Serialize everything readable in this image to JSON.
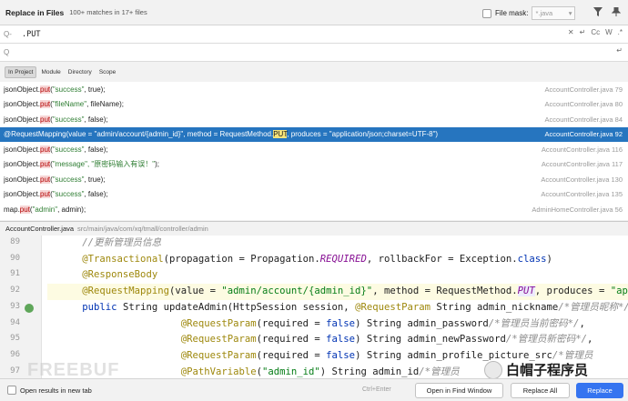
{
  "dialog": {
    "title": "Replace in Files",
    "match_count": "100+ matches in 17+ files",
    "file_mask_label": "File mask:",
    "file_mask_value": "*.java"
  },
  "search": {
    "find_value": ".PUT",
    "replace_value": "",
    "find_options": [
      "Cc",
      "W",
      ".*"
    ]
  },
  "scope_tabs": [
    "In Project",
    "Module",
    "Directory",
    "Scope"
  ],
  "results": [
    {
      "pre": "jsonObject.",
      "match": "put",
      "post_str": "\"success\"",
      "post": ", true);",
      "file": "AccountController.java 79"
    },
    {
      "pre": "jsonObject.",
      "match": "put",
      "post_str": "\"fileName\"",
      "post": ", fileName);",
      "file": "AccountController.java 80"
    },
    {
      "pre": "jsonObject.",
      "match": "put",
      "post_str": "\"success\"",
      "post": ", false);",
      "file": "AccountController.java 84"
    },
    {
      "pre": "@RequestMapping(value = \"admin/account/{admin_id}\", method = RequestMethod.",
      "match": "PUT",
      "post_str": "",
      "post": ", produces = \"application/json;charset=UTF-8\")",
      "file": "AccountController.java 92"
    },
    {
      "pre": "jsonObject.",
      "match": "put",
      "post_str": "\"success\"",
      "post": ", false);",
      "file": "AccountController.java 116"
    },
    {
      "pre": "jsonObject.",
      "match": "put",
      "post_str": "\"message\", \"原密码输入有误！\"",
      "post": ");",
      "file": "AccountController.java 117"
    },
    {
      "pre": "jsonObject.",
      "match": "put",
      "post_str": "\"success\"",
      "post": ", true);",
      "file": "AccountController.java 130"
    },
    {
      "pre": "jsonObject.",
      "match": "put",
      "post_str": "\"success\"",
      "post": ", false);",
      "file": "AccountController.java 135"
    },
    {
      "pre": "map.",
      "match": "put",
      "post_str": "\"admin\"",
      "post": ", admin);",
      "file": "AdminHomeController.java 56"
    }
  ],
  "preview": {
    "file_name": "AccountController.java",
    "file_path": "src/main/java/com/xq/tmall/controller/admin",
    "line_numbers": [
      "89",
      "90",
      "91",
      "92",
      "93",
      "94",
      "95",
      "96",
      "97"
    ],
    "lines": {
      "l89": "//更新管理员信息",
      "l90_ann": "@Transactional",
      "l90_a": "(propagation = Propagation.",
      "l90_b": "REQUIRED",
      "l90_c": ", rollbackFor = Exception.",
      "l90_d": "class",
      "l90_e": ")",
      "l91": "@ResponseBody",
      "l92_ann": "@RequestMapping",
      "l92_a": "(value = ",
      "l92_str": "\"admin/account/{admin_id}\"",
      "l92_b": ", method = RequestMethod.",
      "l92_dot": ".",
      "l92_put": "PUT",
      "l92_c": ", produces = ",
      "l92_str2": "\"applic",
      "l93_kw": "public",
      "l93_a": " String updateAdmin(HttpSession session, ",
      "l93_ann": "@RequestParam",
      "l93_b": " String admin_nickname",
      "l93_cm": "/*管理员昵称*/",
      "l93_c": ",",
      "l94_ann": "@RequestParam",
      "l94_a": "(required = ",
      "l94_kw": "false",
      "l94_b": ") String admin_password",
      "l94_cm": "/*管理员当前密码*/",
      "l94_c": ",",
      "l95_ann": "@RequestParam",
      "l95_a": "(required = ",
      "l95_kw": "false",
      "l95_b": ") String admin_newPassword",
      "l95_cm": "/*管理员新密码*/",
      "l95_c": ",",
      "l96_ann": "@RequestParam",
      "l96_a": "(required = ",
      "l96_kw": "false",
      "l96_b": ") String admin_profile_picture_src",
      "l96_cm": "/*管理员",
      "l97_ann": "@PathVariable",
      "l97_a": "(",
      "l97_str": "\"admin_id\"",
      "l97_b": ") String admin_id",
      "l97_cm": "/*管理员"
    }
  },
  "bottom": {
    "open_new_tab_label": "Open results in new tab",
    "shortcut_hint": "Ctrl+Enter",
    "open_find_window_label": "Open in Find Window",
    "replace_all_label": "Replace All",
    "replace_label": "Replace"
  },
  "watermarks": {
    "left": "FREEBUF",
    "right": "白帽子程序员"
  }
}
